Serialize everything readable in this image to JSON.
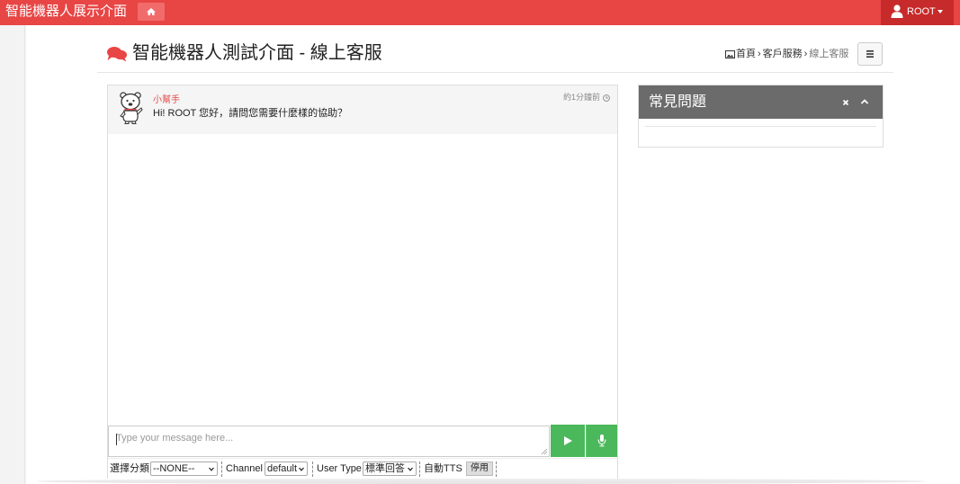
{
  "app": {
    "brand": "智能機器人展示介面"
  },
  "nav": {
    "home_icon": "home-icon",
    "user": "ROOT"
  },
  "page": {
    "title": "智能機器人測試介面 - 線上客服",
    "breadcrumb": [
      "首頁",
      "客戶服務",
      "線上客服"
    ],
    "breadcrumb_sep": "›"
  },
  "chat": {
    "messages": [
      {
        "sender": "小幫手",
        "text": "Hi! ROOT 您好，請問您需要什麼樣的協助？",
        "time": "約1分鐘前"
      }
    ],
    "input": {
      "placeholder": "Type your message here...",
      "value": ""
    }
  },
  "toolbar": {
    "category_label": "選擇分類",
    "category_value": "--NONE--",
    "channel_label": "Channel",
    "channel_value": "default",
    "usertype_label": "User Type",
    "usertype_value": "標準回答",
    "tts_label": "自動TTS",
    "tts_button": "停用"
  },
  "faq": {
    "title": "常見問題"
  },
  "colors": {
    "brand_red": "#e84545",
    "user_red": "#c72a2a",
    "send_green": "#4cb85c",
    "faq_gray": "#6b6b6b"
  }
}
